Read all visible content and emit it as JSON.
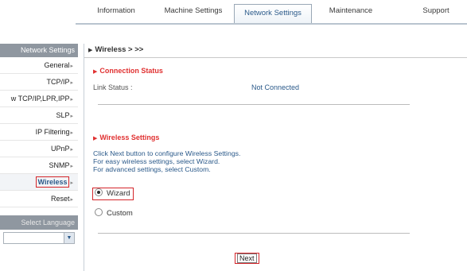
{
  "tabs": [
    {
      "label": "Information",
      "active": false
    },
    {
      "label": "Machine Settings",
      "active": false
    },
    {
      "label": "Network Settings",
      "active": true
    },
    {
      "label": "Maintenance",
      "active": false
    },
    {
      "label": "Support",
      "active": false
    }
  ],
  "sidebar": {
    "header": "Network Settings",
    "items": [
      {
        "label": "General"
      },
      {
        "label": "TCP/IP"
      },
      {
        "label": "w TCP/IP,LPR,IPP"
      },
      {
        "label": "SLP"
      },
      {
        "label": "IP Filtering"
      },
      {
        "label": "UPnP"
      },
      {
        "label": "SNMP"
      },
      {
        "label": "Wireless"
      },
      {
        "label": "Reset"
      }
    ],
    "language_header": "Select Language"
  },
  "main": {
    "breadcrumb": "Wireless > >>",
    "connection_status": {
      "title": "Connection Status",
      "link_status_label": "Link Status :",
      "link_status_value": "Not Connected"
    },
    "wireless_settings": {
      "title": "Wireless Settings",
      "desc_1": "Click Next button to configure Wireless Settings.",
      "desc_2": "For easy wireless settings, select Wizard.",
      "desc_3": "For advanced settings, select Custom.",
      "options": [
        {
          "label": "Wizard",
          "selected": true
        },
        {
          "label": "Custom",
          "selected": false
        }
      ]
    },
    "next_label": "Next"
  },
  "colors": {
    "accent_red": "#e03030",
    "link_blue": "#2b5a8a",
    "sidebar_header": "#8f97a0",
    "highlight_box": "#d4252a"
  }
}
